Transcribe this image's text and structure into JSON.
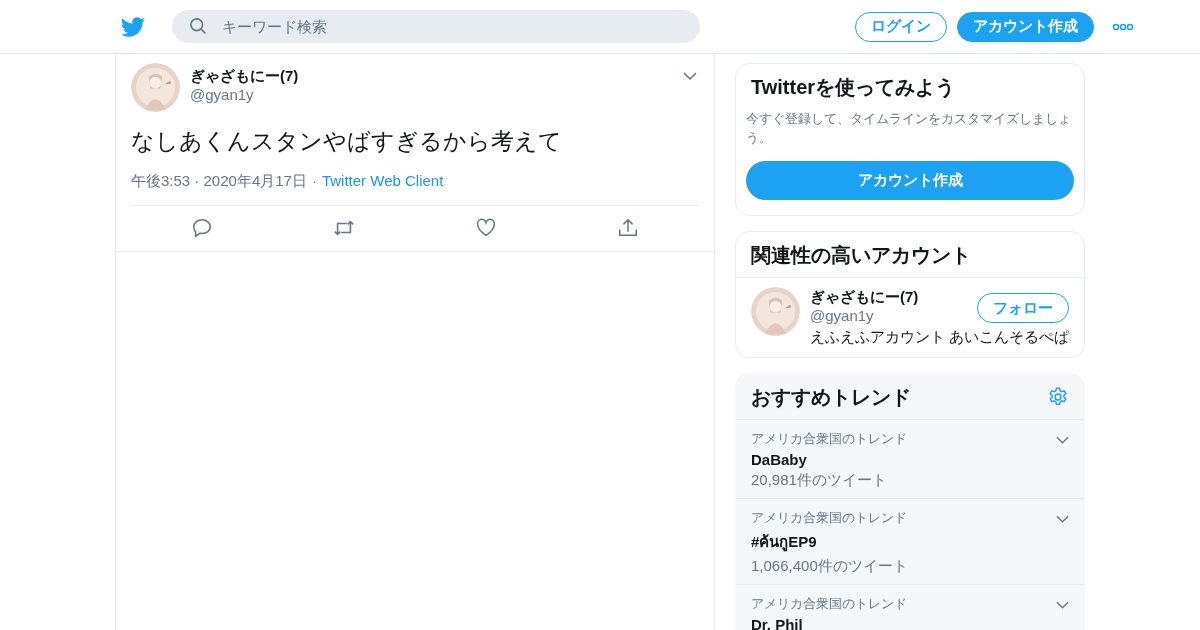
{
  "header": {
    "search": {
      "placeholder": "キーワード検索"
    },
    "buttons": [
      {
        "label": "ログイン",
        "kind": "outline"
      },
      {
        "label": "アカウント作成",
        "kind": "filled"
      }
    ]
  },
  "tweet": {
    "name": "ぎゃざもにー(7)",
    "handle": "@gyan1y",
    "text": "なしあくんスタンやばすぎるから考えて",
    "time": "午後3:53 · 2020年4月17日",
    "separator": "·",
    "client": "Twitter Web Client"
  },
  "signup_card": {
    "title": "Twitterを使ってみよう",
    "description": "今すぐ登録して、タイムラインをカスタマイズしましょう。",
    "button": "アカウント作成"
  },
  "related": {
    "title": "関連性の高いアカウント",
    "accounts": [
      {
        "name": "ぎゃざもにー(7)",
        "handle": "@gyan1y",
        "bio": "えふえふアカウント あいこんそるぺぱ",
        "button": "フォロー"
      }
    ]
  },
  "trends": {
    "title": "おすすめトレンド",
    "items": [
      {
        "context": "アメリカ合衆国のトレンド",
        "name": "DaBaby",
        "count": "20,981件のツイート"
      },
      {
        "context": "アメリカ合衆国のトレンド",
        "name": "#ค้นกูEP9",
        "count": "1,066,400件のツイート"
      },
      {
        "context": "アメリカ合衆国のトレンド",
        "name": "Dr. Phil"
      }
    ]
  }
}
